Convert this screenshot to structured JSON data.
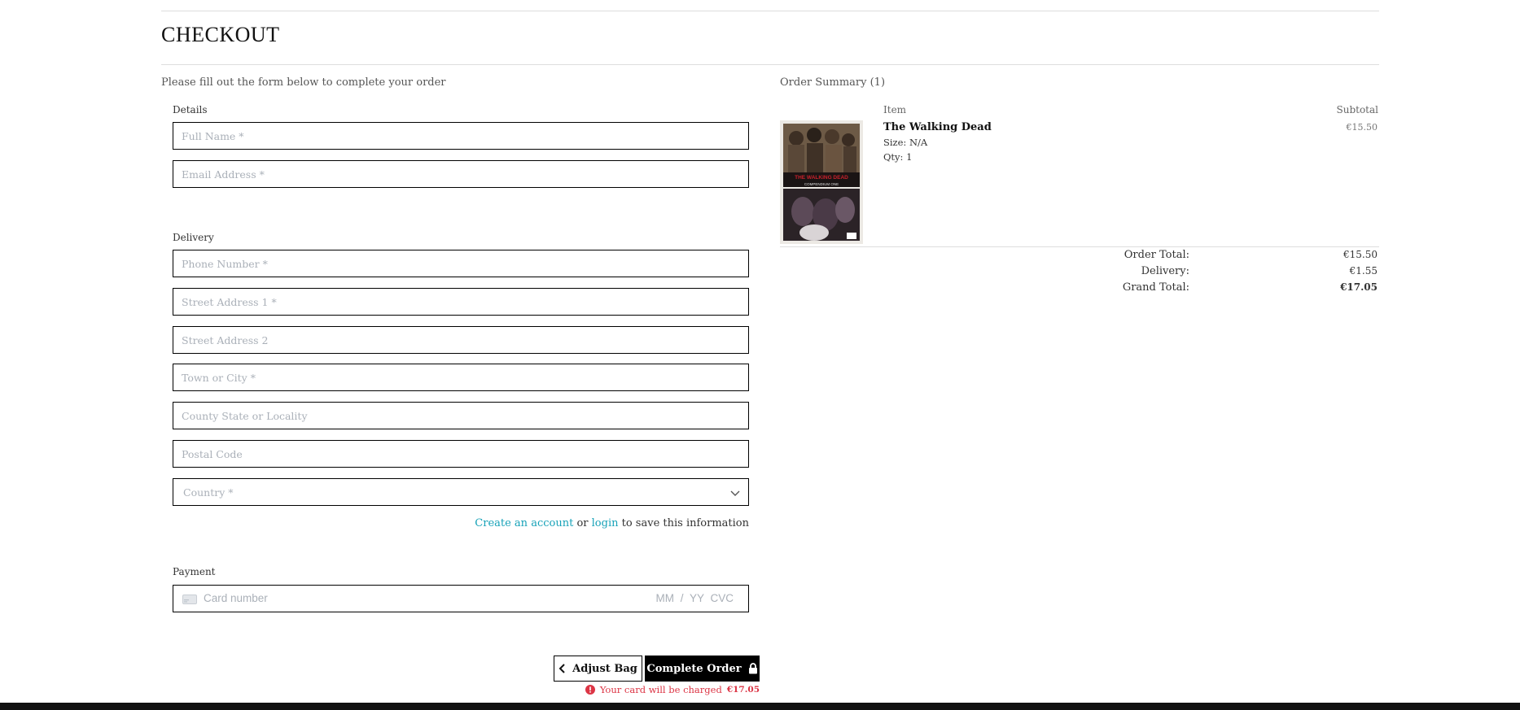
{
  "page": {
    "title": "CHECKOUT",
    "instructions": "Please fill out the form below to complete your order"
  },
  "form": {
    "details_label": "Details",
    "full_name_placeholder": "Full Name *",
    "email_placeholder": "Email Address *",
    "delivery_label": "Delivery",
    "phone_placeholder": "Phone Number *",
    "street1_placeholder": "Street Address 1 *",
    "street2_placeholder": "Street Address 2",
    "town_placeholder": "Town or City *",
    "county_placeholder": "County State or Locality",
    "postcode_placeholder": "Postal Code",
    "country_placeholder": "Country *",
    "save_info": {
      "create_account": "Create an account",
      "or": "or",
      "login": "login",
      "suffix": "to save this information"
    },
    "payment_label": "Payment",
    "card_number_placeholder": "Card number",
    "card_exp_cvc": "MM / YY  CVC"
  },
  "actions": {
    "adjust_bag": "Adjust Bag",
    "complete_order": "Complete Order",
    "charge_note": "Your card will be charged",
    "charge_amount": "€17.05"
  },
  "summary": {
    "title": "Order Summary (1)",
    "col_item": "Item",
    "col_subtotal": "Subtotal",
    "items": [
      {
        "name": "The Walking Dead",
        "size": "Size: N/A",
        "qty": "Qty: 1",
        "price": "€15.50",
        "image_text": "THE WALKING DEAD",
        "image_subtext": "COMPENDIUM ONE"
      }
    ],
    "order_total_label": "Order Total:",
    "order_total": "€15.50",
    "delivery_label": "Delivery:",
    "delivery": "€1.55",
    "grand_total_label": "Grand Total:",
    "grand_total": "€17.05"
  },
  "colors": {
    "accent_link": "#17a2b8",
    "danger": "#dc3545",
    "primary_button": "#000000"
  }
}
